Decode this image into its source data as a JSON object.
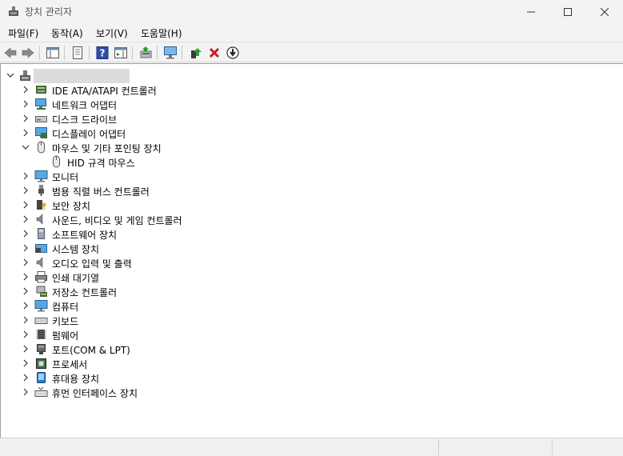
{
  "window": {
    "title": "장치 관리자",
    "controls": {
      "minimize": "minimize-icon",
      "maximize": "maximize-icon",
      "close": "close-icon"
    }
  },
  "menu": [
    {
      "label": "파일(F)"
    },
    {
      "label": "동작(A)"
    },
    {
      "label": "보기(V)"
    },
    {
      "label": "도움말(H)"
    }
  ],
  "toolbar": {
    "buttons": [
      "back-arrow-icon",
      "forward-arrow-icon",
      "show-hide-tree-icon",
      "properties-icon",
      "help-icon",
      "action-pane-icon",
      "update-driver-icon",
      "scan-hardware-icon",
      "enable-device-icon",
      "uninstall-device-icon",
      "disable-device-icon"
    ],
    "accent_red": "#d11a1a",
    "accent_blue": "#1a5fb4"
  },
  "tree": {
    "computer_name": "",
    "categories": [
      {
        "label": "IDE ATA/ATAPI 컨트롤러",
        "icon": "ide-controller-icon",
        "expanded": false
      },
      {
        "label": "네트워크 어댑터",
        "icon": "network-adapter-icon",
        "expanded": false
      },
      {
        "label": "디스크 드라이브",
        "icon": "disk-drive-icon",
        "expanded": false
      },
      {
        "label": "디스플레이 어댑터",
        "icon": "display-adapter-icon",
        "expanded": false
      },
      {
        "label": "마우스 및 기타 포인팅 장치",
        "icon": "mouse-icon",
        "expanded": true,
        "children": [
          {
            "label": "HID 규격 마우스",
            "icon": "mouse-icon"
          }
        ]
      },
      {
        "label": "모니터",
        "icon": "monitor-icon",
        "expanded": false
      },
      {
        "label": "범용 직렬 버스 컨트롤러",
        "icon": "usb-icon",
        "expanded": false
      },
      {
        "label": "보안 장치",
        "icon": "security-device-icon",
        "expanded": false
      },
      {
        "label": "사운드, 비디오 및 게임 컨트롤러",
        "icon": "speaker-icon",
        "expanded": false
      },
      {
        "label": "소프트웨어 장치",
        "icon": "software-device-icon",
        "expanded": false
      },
      {
        "label": "시스템 장치",
        "icon": "system-device-icon",
        "expanded": false
      },
      {
        "label": "오디오 입력 및 출력",
        "icon": "speaker-icon",
        "expanded": false
      },
      {
        "label": "인쇄 대기열",
        "icon": "printer-icon",
        "expanded": false
      },
      {
        "label": "저장소 컨트롤러",
        "icon": "storage-controller-icon",
        "expanded": false
      },
      {
        "label": "컴퓨터",
        "icon": "computer-icon",
        "expanded": false
      },
      {
        "label": "키보드",
        "icon": "keyboard-icon",
        "expanded": false
      },
      {
        "label": "펌웨어",
        "icon": "firmware-chip-icon",
        "expanded": false
      },
      {
        "label": "포트(COM & LPT)",
        "icon": "port-icon",
        "expanded": false
      },
      {
        "label": "프로세서",
        "icon": "processor-icon",
        "expanded": false
      },
      {
        "label": "휴대용 장치",
        "icon": "portable-device-icon",
        "expanded": false
      },
      {
        "label": "휴먼 인터페이스 장치",
        "icon": "hid-icon",
        "expanded": false
      }
    ]
  }
}
